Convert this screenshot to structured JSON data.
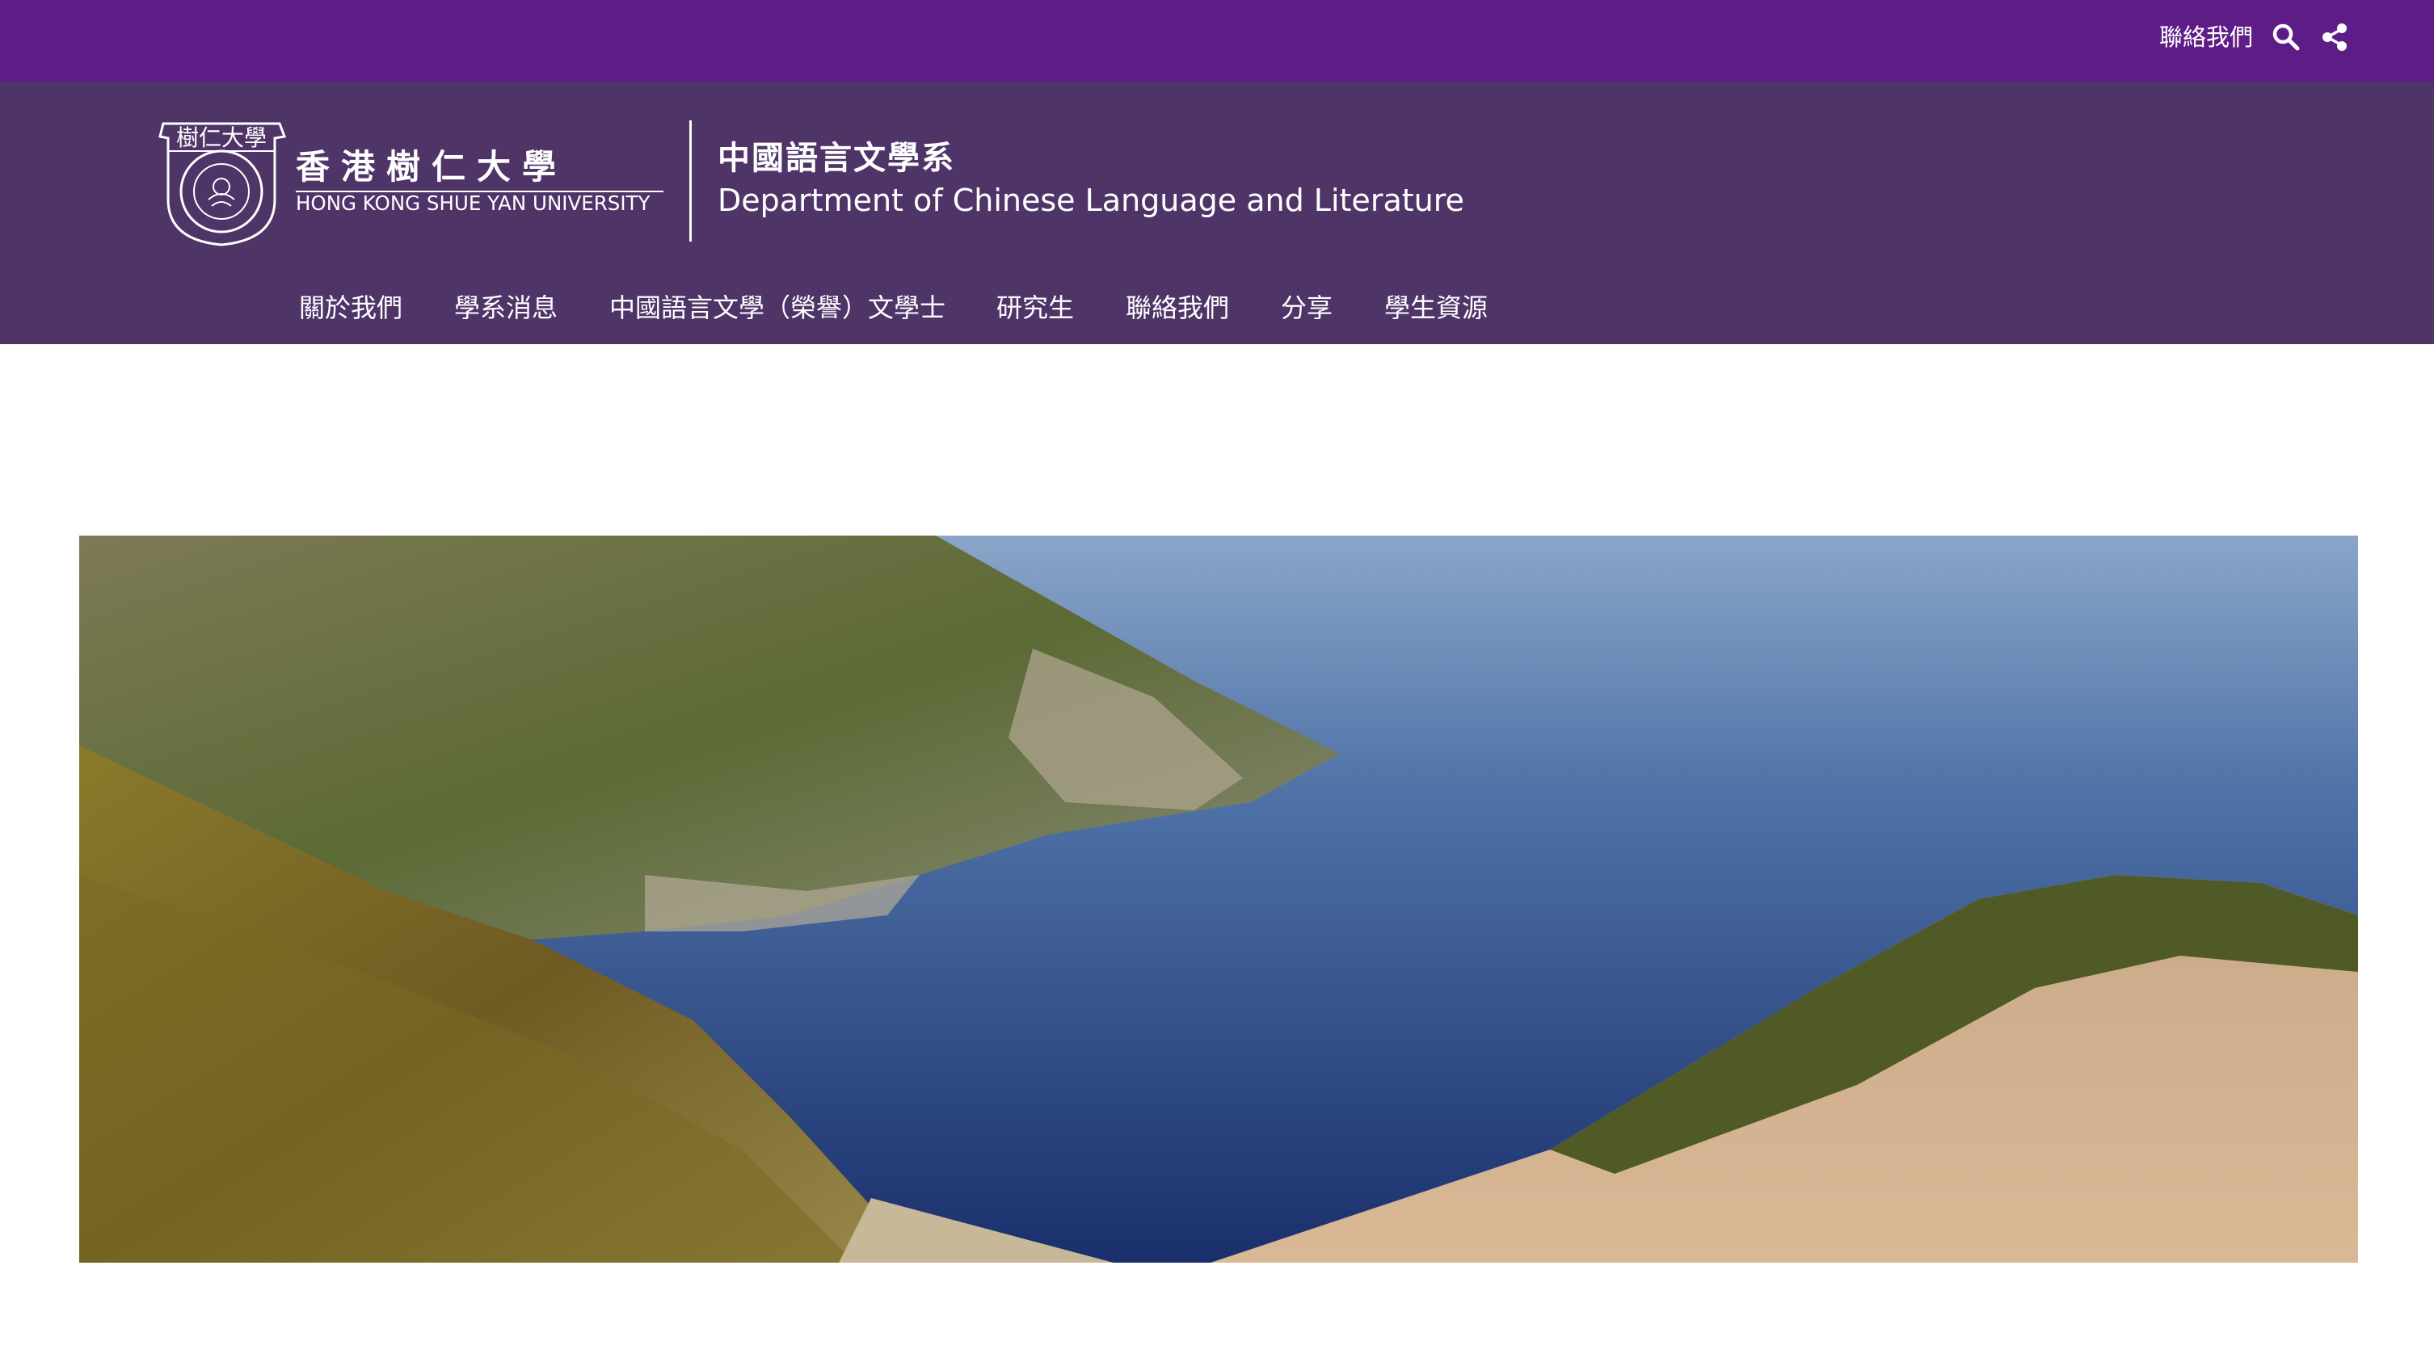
{
  "colors": {
    "topbar": "#5e1d86",
    "header": "#4f3468",
    "text": "#ffffff"
  },
  "topbar": {
    "contact_label": "聯絡我們",
    "search_icon": "search-icon",
    "share_icon": "share-icon"
  },
  "university": {
    "seal_text": "樹仁大學",
    "name_cn": "香港樹仁大學",
    "name_en": "HONG KONG SHUE YAN UNIVERSITY"
  },
  "department": {
    "name_cn": "中國語言文學系",
    "name_en": "Department of Chinese Language and Literature"
  },
  "nav": {
    "items": [
      {
        "label": "關於我們"
      },
      {
        "label": "學系消息"
      },
      {
        "label": "中國語言文學（榮譽）文學士"
      },
      {
        "label": "研究生"
      },
      {
        "label": "聯絡我們"
      },
      {
        "label": "分享"
      },
      {
        "label": "學生資源"
      }
    ]
  },
  "hero": {
    "image": "coastal-cliffs-sea-photo"
  }
}
